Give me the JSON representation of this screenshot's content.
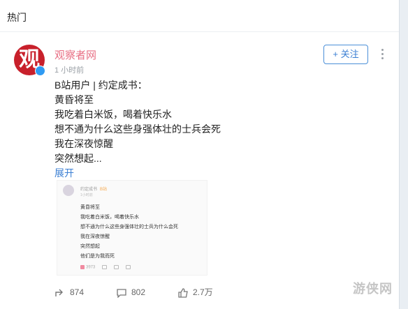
{
  "header": {
    "title": "热门"
  },
  "post": {
    "author": "观察者网",
    "avatar_glyph": "观",
    "time": "1 小时前",
    "follow_label": "+ 关注",
    "lines": [
      "B站用户 | 约定成书：",
      "黄昏将至",
      "我吃着白米饭，喝着快乐水",
      "想不通为什么这些身强体壮的士兵会死",
      "我在深夜惊醒",
      "突然想起..."
    ],
    "expand_label": "展开",
    "embed": {
      "name": "约定成书",
      "tag": "B站",
      "time": "1小时前",
      "lines": [
        "黄昏将至",
        "我吃着白米饭，喝着快乐水",
        "想不通为什么这些身强体壮的士兵为什么会死",
        "我在深夜惊醒",
        "突然想起",
        "他们是为我而死"
      ],
      "likes": "3973"
    },
    "stats": {
      "shares": "874",
      "comments": "802",
      "likes": "2.7万"
    }
  },
  "watermark": "游侠网",
  "colors": {
    "accent": "#3b7fd3",
    "author": "#e86f84",
    "avatar_bg": "#c8202b"
  },
  "icons": [
    "verified-icon",
    "more-icon",
    "share-icon",
    "comment-icon",
    "like-icon"
  ]
}
